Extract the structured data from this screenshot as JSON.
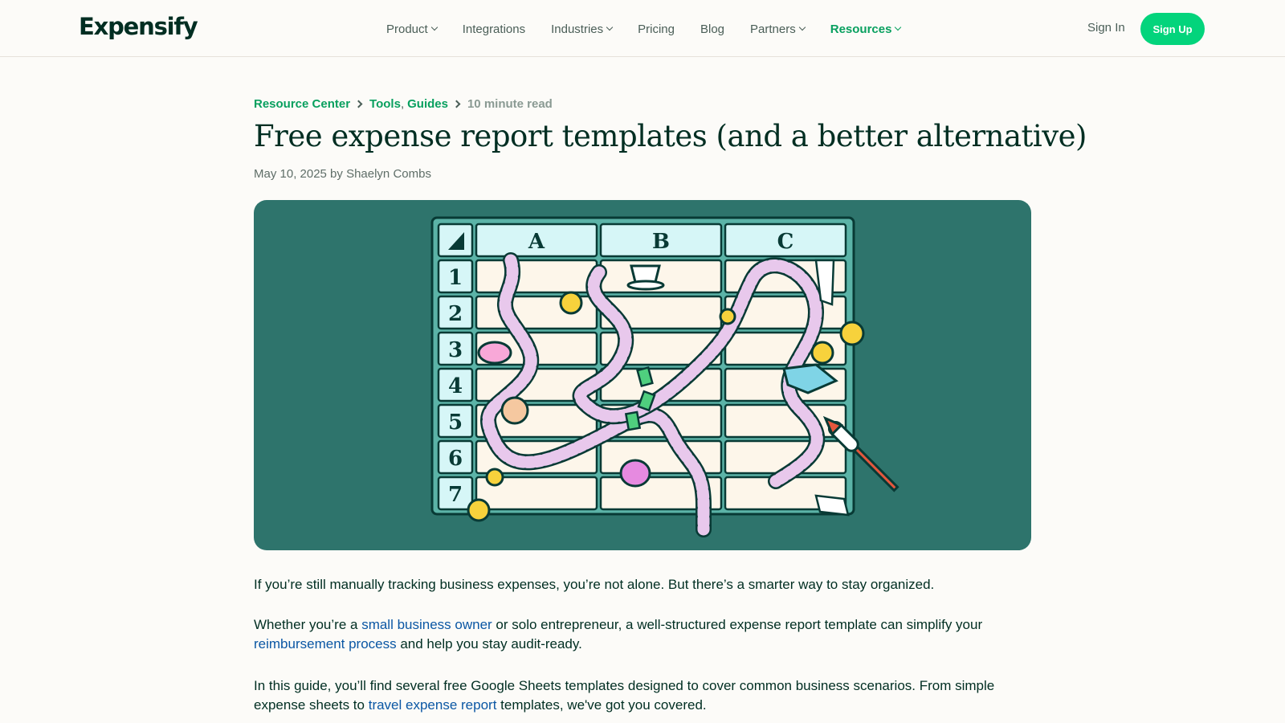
{
  "header": {
    "logo": "Expensify",
    "nav": [
      {
        "label": "Product",
        "has_dropdown": true
      },
      {
        "label": "Integrations",
        "has_dropdown": false
      },
      {
        "label": "Industries",
        "has_dropdown": true
      },
      {
        "label": "Pricing",
        "has_dropdown": false
      },
      {
        "label": "Blog",
        "has_dropdown": false
      },
      {
        "label": "Partners",
        "has_dropdown": true
      },
      {
        "label": "Resources",
        "has_dropdown": true,
        "active": true
      }
    ],
    "sign_in": "Sign In",
    "sign_up": "Sign Up"
  },
  "breadcrumb": {
    "root": "Resource Center",
    "categories": [
      "Tools",
      "Guides"
    ],
    "read_time": "10 minute read"
  },
  "article": {
    "title": "Free expense report templates (and a better alternative)",
    "byline": "May 10, 2025 by Shaelyn Combs",
    "hero_grid": {
      "columns": [
        "A",
        "B",
        "C"
      ],
      "rows": [
        "1",
        "2",
        "3",
        "4",
        "5",
        "6",
        "7"
      ]
    },
    "paragraphs": [
      {
        "p1": "If you’re still manually tracking business expenses, you’re not alone. But there’s a smarter way to stay organized."
      },
      {
        "pre": "Whether you’re a ",
        "link1": "small business owner",
        "mid": " or solo entrepreneur, a well-structured expense report template can simplify your ",
        "link2": "reimbursement process",
        "post": " and help you stay audit-ready."
      },
      {
        "pre": "In this guide, you’ll find several free Google Sheets templates designed to cover common business scenarios. From simple expense sheets to ",
        "link": "travel expense report",
        "post": " templates, we've got you covered."
      }
    ]
  },
  "colors": {
    "brand_green": "#03d47c",
    "link_blue": "#0b57a4",
    "hero_bg": "#2e746c",
    "text_dark": "#002e22"
  }
}
